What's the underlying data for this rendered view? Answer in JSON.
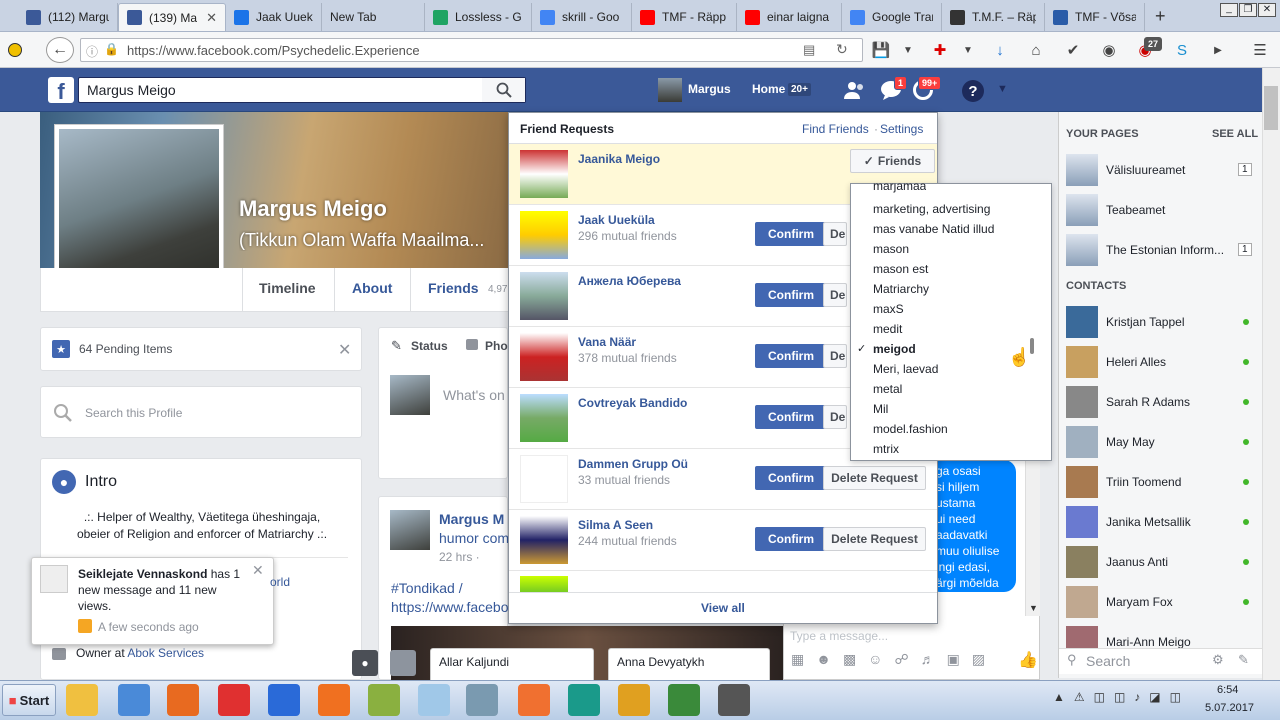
{
  "browser": {
    "tabs": [
      {
        "title": "(112) Margu",
        "icon": "facebook-icon",
        "color": "#3b5998"
      },
      {
        "title": "(139) Ma",
        "icon": "facebook-icon",
        "color": "#3b5998",
        "active": true
      },
      {
        "title": "Jaak Uuekül",
        "icon": "loading-icon",
        "color": "#1a73e8"
      },
      {
        "title": "New Tab",
        "icon": "",
        "color": ""
      },
      {
        "title": "Lossless - G",
        "icon": "google-drive-icon",
        "color": "#1fa463"
      },
      {
        "title": "skrill - Goo",
        "icon": "google-icon",
        "color": "#4285f4"
      },
      {
        "title": "TMF - Räpp",
        "icon": "youtube-icon",
        "color": "#ff0000"
      },
      {
        "title": "einar laigna",
        "icon": "youtube-icon",
        "color": "#ff0000"
      },
      {
        "title": "Google Trar",
        "icon": "google-translate-icon",
        "color": "#4285f4"
      },
      {
        "title": "T.M.F. – Räp",
        "icon": "tmf-icon",
        "color": "#333333"
      },
      {
        "title": "TMF - Võsa",
        "icon": "site-icon",
        "color": "#2a5ca8"
      }
    ],
    "url": "https://www.facebook.com/Psychedelic.Experience",
    "url_host": "facebook.com",
    "addon_badge": "27",
    "window_controls": [
      "_",
      "❐",
      "✕"
    ]
  },
  "fb": {
    "search_value": "Margus Meigo",
    "user_name": "Margus",
    "home_label": "Home",
    "home_count": "20+",
    "messages_badge": "1",
    "notif_badge": "99+",
    "profile_name": "Margus Meigo",
    "profile_sub": "(Tikkun Olam Waffa Maailma...",
    "tabs": [
      "Timeline",
      "About",
      "Friends"
    ],
    "friends_count": "4,97",
    "pending_items": "64 Pending Items",
    "search_profile_placeholder": "Search this Profile",
    "intro_title": "Intro",
    "intro_text": ".:. Helper of Wealthy, Väetitega üheshingaja, obeier of Religion and enforcer of Matriarchy .:.",
    "owner_prefix": "Owner at",
    "owner_link": "Abok Services",
    "status_label": "Status",
    "photo_label": "Pho",
    "whats_on": "What's on",
    "post_author": "Margus M",
    "post_sub": "humor com",
    "post_time": "22 hrs ·",
    "post_tag": "#Tondikad /",
    "post_link": "https://www.faceboo",
    "notification": {
      "title": "Seiklejate Vennaskond",
      "text": "has 1 new message and 11 new views.",
      "time": "A few seconds ago",
      "partial": "orld"
    },
    "chat_tabs": [
      "Allar Kaljundi",
      "Anna Devyatykh"
    ],
    "chat_text": [
      "ga osasi",
      "si hiljem",
      "ustama",
      "ui need",
      "aadavatki",
      "muu oliulise",
      "ingi edasi,",
      "ärgi mõelda"
    ],
    "chat_placeholder": "Type a message..."
  },
  "friend_requests": {
    "title": "Friend Requests",
    "find_friends": "Find Friends",
    "settings": "Settings",
    "friends_btn": "Friends",
    "confirm": "Confirm",
    "delete": "Delete Request",
    "delete_short": "Dele",
    "view_all": "View all",
    "items": [
      {
        "name": "Jaanika Meigo",
        "mutual": ""
      },
      {
        "name": "Jaak Uueküla",
        "mutual": "296 mutual friends"
      },
      {
        "name": "Анжела Юберева",
        "mutual": ""
      },
      {
        "name": "Vana Näär",
        "mutual": "378 mutual friends"
      },
      {
        "name": "Covtreyak Bandido",
        "mutual": ""
      },
      {
        "name": "Dammen Grupp Oü",
        "mutual": "33 mutual friends"
      },
      {
        "name": "Silma A Seen",
        "mutual": "244 mutual friends"
      }
    ]
  },
  "friend_lists": {
    "items": [
      "Marjamaa",
      "marketing, advertising",
      "mas vanabe Natid illud",
      "mason",
      "mason est",
      "Matriarchy",
      "maxS",
      "medit",
      "meigod",
      "Meri, laevad",
      "metal",
      "Mil",
      "model.fashion",
      "mtrix"
    ],
    "checked": "meigod"
  },
  "right": {
    "your_pages": "YOUR PAGES",
    "see_all": "SEE ALL",
    "pages": [
      {
        "name": "Välisluureamet",
        "count": "1"
      },
      {
        "name": "Teabeamet",
        "count": ""
      },
      {
        "name": "The Estonian Inform...",
        "count": "1"
      }
    ],
    "contacts_title": "CONTACTS",
    "contacts": [
      "Kristjan Tappel",
      "Heleri Alles",
      "Sarah R Adams",
      "May May",
      "Triin Toomend",
      "Janika Metsallik",
      "Jaanus Anti",
      "Maryam Fox",
      "Mari-Ann Meigo"
    ],
    "search_placeholder": "Search"
  },
  "taskbar": {
    "start": "Start",
    "time": "6:54",
    "date": "5.07.2017"
  }
}
